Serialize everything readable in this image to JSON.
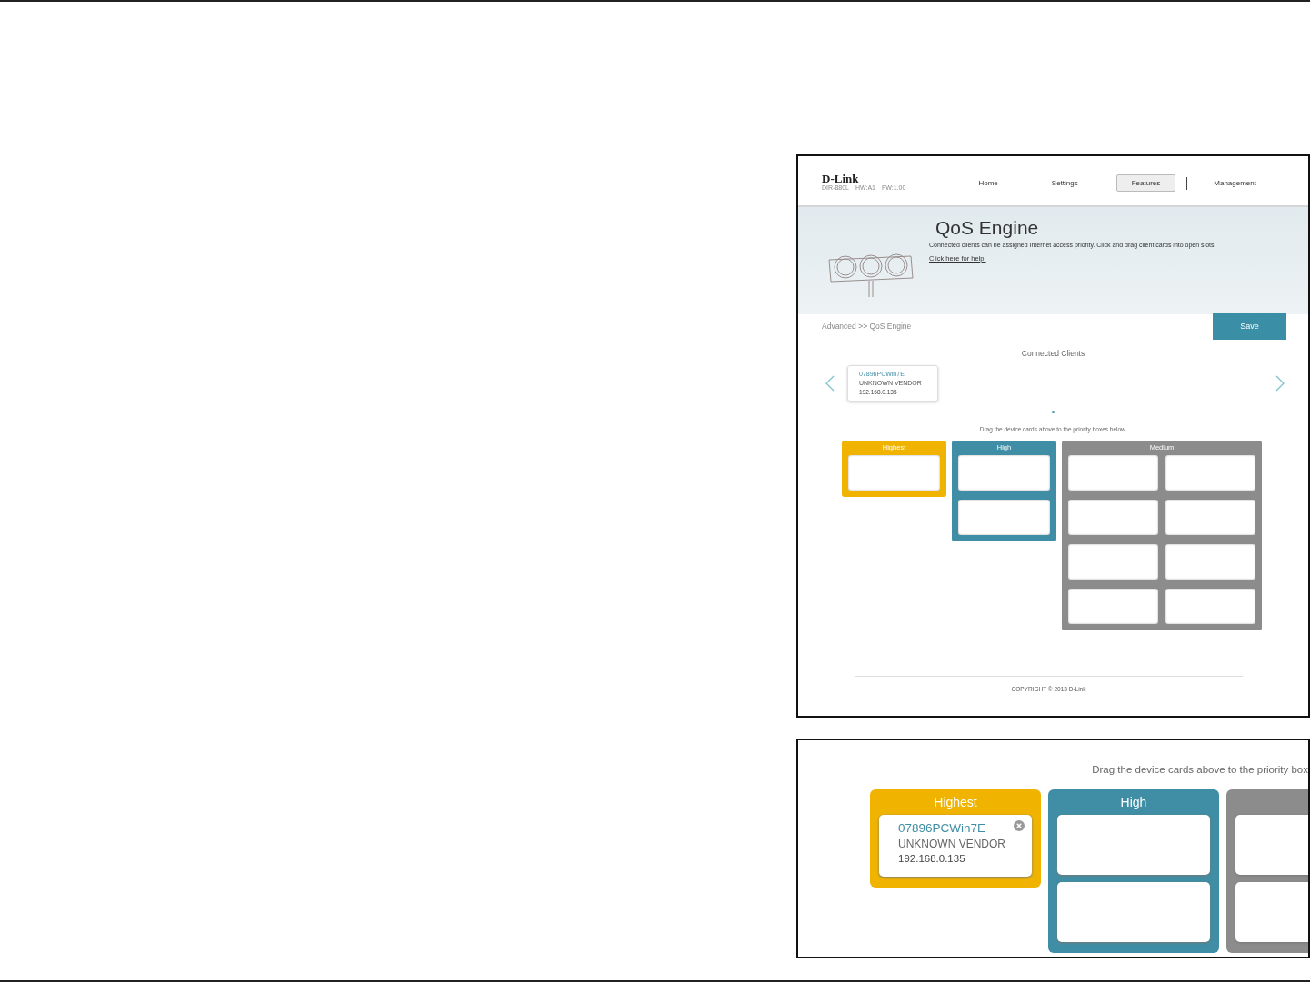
{
  "main_screenshot": {
    "header": {
      "logo": "D-Link",
      "model_info": [
        "DIR-880L",
        "HW:A1",
        "FW:1.00"
      ],
      "nav": [
        {
          "label": "Home",
          "selected": false
        },
        {
          "label": "Settings",
          "selected": false
        },
        {
          "label": "Features",
          "selected": true
        },
        {
          "label": "Management",
          "selected": false
        }
      ]
    },
    "banner": {
      "title": "QoS Engine",
      "description": "Connected clients can be assigned Internet access priority. Click and drag client cards into open slots.",
      "help_link": "Click here for help."
    },
    "breadcrumb": "Advanced >> QoS Engine",
    "save_button": "Save",
    "connected_clients": {
      "title": "Connected Clients",
      "clients": [
        {
          "name": "07896PCWin7E",
          "vendor": "UNKNOWN VENDOR",
          "ip": "192.168.0.135"
        }
      ]
    },
    "drag_hint": "Drag the device cards above to the priority boxes below.",
    "priority_groups": [
      {
        "label": "Highest",
        "color": "#f0b400",
        "slots": [
          {
            "kind": "empty"
          }
        ]
      },
      {
        "label": "High",
        "color": "#3f8ea5",
        "slots": [
          {
            "kind": "empty"
          },
          {
            "kind": "empty"
          }
        ]
      },
      {
        "label": "Medium",
        "color": "#8c8c8c",
        "slots": [
          {
            "kind": "empty"
          },
          {
            "kind": "empty"
          },
          {
            "kind": "empty"
          },
          {
            "kind": "empty"
          },
          {
            "kind": "empty"
          },
          {
            "kind": "empty"
          },
          {
            "kind": "empty"
          },
          {
            "kind": "empty"
          }
        ]
      }
    ],
    "footer": "COPYRIGHT © 2013 D-Link"
  },
  "zoom_screenshot": {
    "drag_hint": "Drag the device cards above to the priority box",
    "priority_groups": [
      {
        "label": "Highest",
        "color": "#f0b400",
        "slots": [
          {
            "kind": "client",
            "name": "07896PCWin7E",
            "vendor": "UNKNOWN VENDOR",
            "ip": "192.168.0.135"
          }
        ]
      },
      {
        "label": "High",
        "color": "#3f8ea5",
        "slots": [
          {
            "kind": "empty"
          },
          {
            "kind": "empty"
          }
        ]
      },
      {
        "color": "#8c8c8c",
        "slots": [
          {
            "kind": "empty"
          },
          {
            "kind": "empty"
          }
        ]
      }
    ]
  }
}
